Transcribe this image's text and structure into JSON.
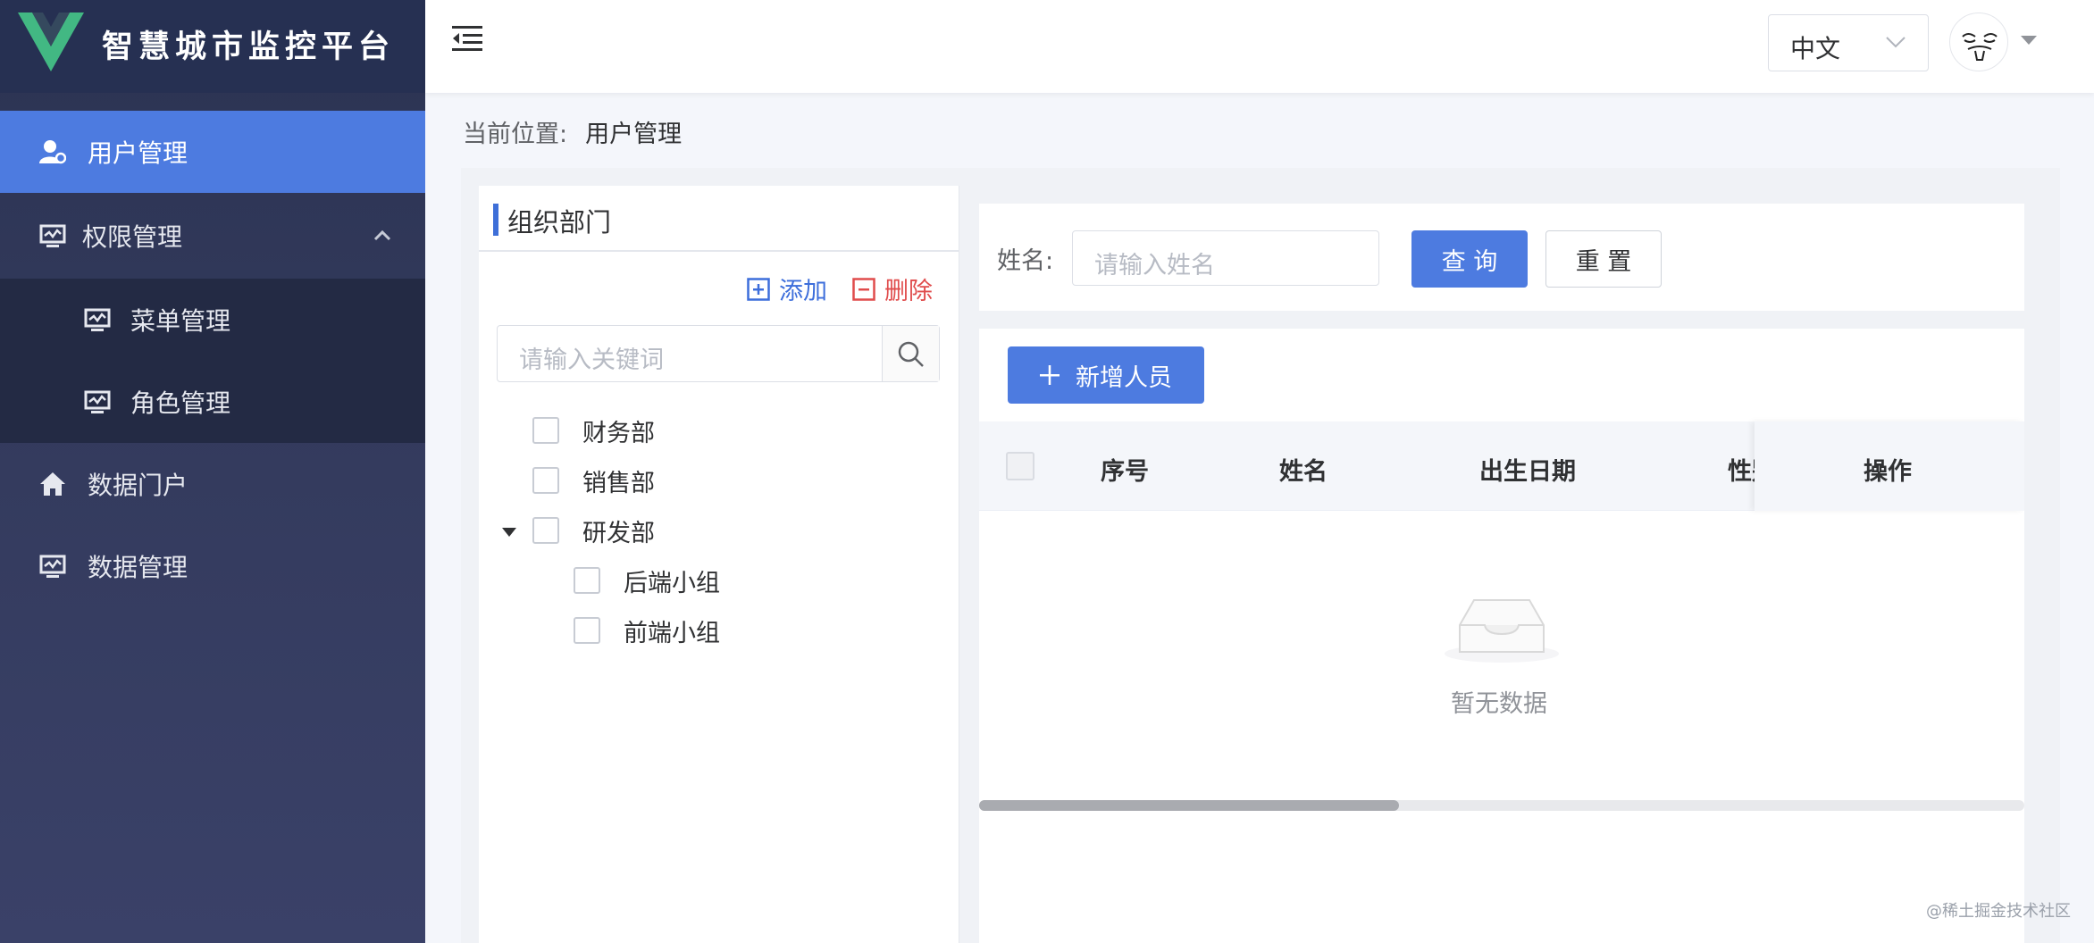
{
  "app": {
    "title": "智慧城市监控平台"
  },
  "sidebar": {
    "items": [
      {
        "label": "用户管理",
        "icon": "user-gear-icon"
      },
      {
        "label": "权限管理",
        "icon": "monitor-chart-icon"
      },
      {
        "label": "菜单管理",
        "icon": "monitor-chart-icon"
      },
      {
        "label": "角色管理",
        "icon": "monitor-chart-icon"
      },
      {
        "label": "数据门户",
        "icon": "home-icon"
      },
      {
        "label": "数据管理",
        "icon": "monitor-chart-icon"
      }
    ]
  },
  "header": {
    "language": "中文"
  },
  "breadcrumb": {
    "prefix": "当前位置:",
    "current": "用户管理"
  },
  "tree": {
    "title": "组织部门",
    "add_label": "添加",
    "delete_label": "删除",
    "search_placeholder": "请输入关键词",
    "nodes": [
      {
        "label": "财务部"
      },
      {
        "label": "销售部"
      },
      {
        "label": "研发部",
        "expanded": true
      },
      {
        "label": "后端小组"
      },
      {
        "label": "前端小组"
      }
    ]
  },
  "query": {
    "name_label": "姓名:",
    "name_placeholder": "请输入姓名",
    "search_button": "查 询",
    "reset_button": "重 置"
  },
  "table": {
    "add_button": "新增人员",
    "columns": [
      "序号",
      "姓名",
      "出生日期",
      "性别",
      "操作"
    ],
    "empty_text": "暂无数据"
  },
  "watermark": "@稀土掘金技术社区",
  "colors": {
    "primary": "#4d7be0",
    "danger": "#e04c4c",
    "sidebar": "#2b3352"
  }
}
